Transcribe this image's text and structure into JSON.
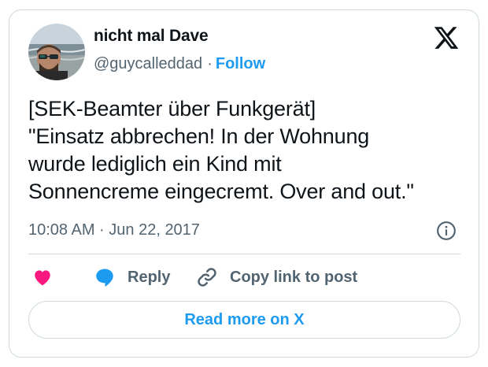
{
  "author": {
    "display_name": "nicht mal Dave",
    "handle": "@guycalleddad",
    "separator": "·",
    "follow_label": "Follow"
  },
  "tweet": {
    "lines": [
      "[SEK-Beamter über Funkgerät]",
      "\"Einsatz abbrechen! In der Wohnung",
      "wurde lediglich ein Kind mit",
      "Sonnencreme eingecremt. Over and out.\""
    ],
    "timestamp": "10:08 AM · Jun 22, 2017"
  },
  "actions": {
    "like_icon": "heart-icon",
    "reply_label": "Reply",
    "copy_link_label": "Copy link to post"
  },
  "footer": {
    "read_more_label": "Read more on X"
  },
  "colors": {
    "accent": "#1d9bf0",
    "like": "#f91880",
    "text_primary": "#0f1419",
    "text_secondary": "#536471",
    "border": "#cfd9de"
  }
}
